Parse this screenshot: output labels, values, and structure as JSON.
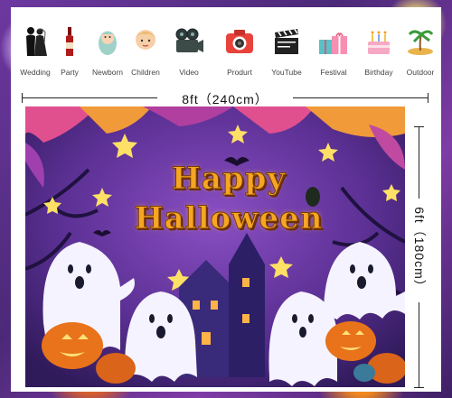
{
  "icons": [
    {
      "label": "Wedding",
      "icon": "couple-icon"
    },
    {
      "label": "Party",
      "icon": "wine-bottle-icon"
    },
    {
      "label": "Newborn",
      "icon": "baby-icon"
    },
    {
      "label": "Children",
      "icon": "child-face-icon"
    },
    {
      "label": "Video",
      "icon": "video-camera-icon"
    },
    {
      "label": "Produrt",
      "icon": "photo-camera-icon"
    },
    {
      "label": "YouTube",
      "icon": "clapperboard-icon"
    },
    {
      "label": "Festival",
      "icon": "gift-boxes-icon"
    },
    {
      "label": "Birthday",
      "icon": "birthday-cake-icon"
    },
    {
      "label": "Outdoor",
      "icon": "palm-island-icon"
    }
  ],
  "dimensions": {
    "width_label": "8ft（240cm）",
    "height_label": "6ft（180cm）"
  },
  "banner": {
    "title_line1": "Happy",
    "title_line2": "Halloween"
  },
  "colors": {
    "banner_purple": "#4a2a7a",
    "title_orange": "#f5a623",
    "pumpkin_orange": "#e8731a",
    "ghost_white": "#f5f3ff"
  }
}
